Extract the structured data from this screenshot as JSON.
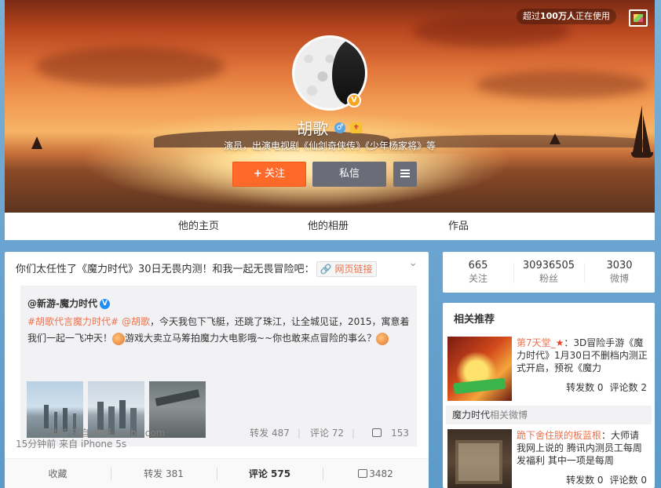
{
  "cover": {
    "users_badge_prefix": "超过",
    "users_badge_bold": "100万人",
    "users_badge_suffix": "正在使用",
    "skin_icon": "palette-icon"
  },
  "profile": {
    "name": "胡歌",
    "verified_icon": "v-icon",
    "verified_mark": "V",
    "gender_icon": "male-icon",
    "gender_symbol": "♂",
    "level_icon": "vip-level-icon",
    "intro": "演员，出演电视剧《仙剑奇侠传》《少年杨家将》等",
    "follow_label": "关注",
    "follow_plus": "+",
    "message_label": "私信",
    "menu_icon": "menu-icon"
  },
  "nav": {
    "items": [
      {
        "label": "他的主页"
      },
      {
        "label": "他的相册"
      },
      {
        "label": "作品"
      }
    ]
  },
  "post": {
    "text": "你们太任性了《魔力时代》30日无畏内测！和我一起无畏冒险吧：",
    "link_label": "网页链接",
    "link_icon": "link-icon",
    "chevron_icon": "chevron-down-icon",
    "chevron_glyph": "⌄",
    "repost": {
      "author": "@新游-魔力时代",
      "verified_mark": "V",
      "tag": "#胡歌代言魔力时代#",
      "mention": "@胡歌",
      "text_part1": "，今天我包下飞艇，还跳了珠江，让全城见证，2015，寓意着我们一起一飞冲天！",
      "text_part2": "游戏大卖立马筹拍魔力大电影哦~~你也敢来点冒险的事么？",
      "emoji_icon": "fist-emoji-icon",
      "time_source": "54分钟前 来自 微博 weibo.com",
      "repost_count": "转发 487",
      "comment_count": "评论 72",
      "like_count": "153"
    },
    "time_source": "15分钟前 来自 iPhone 5s",
    "actions": {
      "favorite": "收藏",
      "repost": "转发 381",
      "comment": "评论 575",
      "like": "3482"
    }
  },
  "stats": [
    {
      "num": "665",
      "label": "关注"
    },
    {
      "num": "30936505",
      "label": "粉丝"
    },
    {
      "num": "3030",
      "label": "微博"
    }
  ],
  "recommend": {
    "title": "相关推荐",
    "items": [
      {
        "who": "第7天堂_",
        "badge": "★",
        "text": "：3D冒险手游《魔力时代》1月30日不删档内测正式开启，预祝《魔力",
        "repost": "转发数 0",
        "comment": "评论数 2",
        "foot_a": "魔力时代",
        "foot_b": "相关微博"
      },
      {
        "who": "跪下舍住朕的板蓝根",
        "text": "：大师请我网上说的 腾讯内测员工每周发福利 其中一项是每周",
        "repost": "转发数 0",
        "comment": "评论数 0"
      }
    ]
  }
}
